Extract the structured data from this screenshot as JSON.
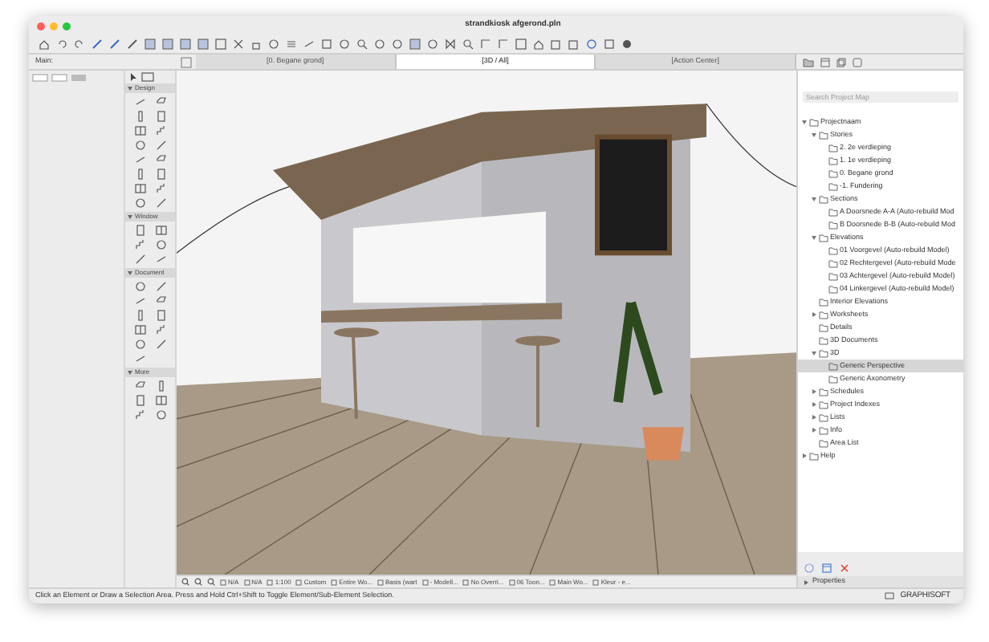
{
  "window": {
    "title": "strandkiosk afgerond.pln"
  },
  "tabs": [
    {
      "label": "[0. Begane grond]",
      "selected": false
    },
    {
      "label": "[3D / All]",
      "selected": true
    },
    {
      "label": "[Action Center]",
      "selected": false
    }
  ],
  "info_box": {
    "label": "Main:"
  },
  "toolbox": {
    "sections": [
      {
        "title": "Design",
        "expanded": true
      },
      {
        "title": "Window",
        "expanded": true
      },
      {
        "title": "Document",
        "expanded": true
      },
      {
        "title": "More",
        "expanded": true
      }
    ]
  },
  "navigator": {
    "search": {
      "placeholder": "Search Project Map"
    },
    "tree": [
      {
        "label": "Projectnaam",
        "expanded": true,
        "selected": false,
        "children": [
          {
            "label": "Stories",
            "expanded": true,
            "selected": false,
            "children": [
              {
                "label": "2. 2e verdieping",
                "selected": false
              },
              {
                "label": "1. 1e verdieping",
                "selected": false
              },
              {
                "label": "0. Begane grond",
                "selected": false
              },
              {
                "label": "-1. Fundering",
                "selected": false
              }
            ]
          },
          {
            "label": "Sections",
            "expanded": true,
            "selected": false,
            "children": [
              {
                "label": "A Doorsnede A-A (Auto-rebuild Mod",
                "selected": false
              },
              {
                "label": "B Doorsnede B-B (Auto-rebuild Mod",
                "selected": false
              }
            ]
          },
          {
            "label": "Elevations",
            "expanded": true,
            "selected": false,
            "children": [
              {
                "label": "01 Voorgevel (Auto-rebuild Model)",
                "selected": false
              },
              {
                "label": "02 Rechtergevel (Auto-rebuild Mode",
                "selected": false
              },
              {
                "label": "03 Achtergevel (Auto-rebuild Model)",
                "selected": false
              },
              {
                "label": "04 Linkergevel (Auto-rebuild Model)",
                "selected": false
              }
            ]
          },
          {
            "label": "Interior Elevations",
            "selected": false
          },
          {
            "label": "Worksheets",
            "expanded": false,
            "selected": false
          },
          {
            "label": "Details",
            "selected": false
          },
          {
            "label": "3D Documents",
            "selected": false
          },
          {
            "label": "3D",
            "expanded": true,
            "selected": false,
            "children": [
              {
                "label": "Generic Perspective",
                "selected": true
              },
              {
                "label": "Generic Axonometry",
                "selected": false
              }
            ]
          },
          {
            "label": "Schedules",
            "expanded": false,
            "selected": false
          },
          {
            "label": "Project Indexes",
            "expanded": false,
            "selected": false
          },
          {
            "label": "Lists",
            "expanded": false,
            "selected": false
          },
          {
            "label": "Info",
            "expanded": false,
            "selected": false
          },
          {
            "label": "Area List",
            "selected": false
          }
        ]
      },
      {
        "label": "Help",
        "expanded": false,
        "selected": false
      }
    ],
    "properties": {
      "title": "Properties",
      "expanded": false
    }
  },
  "view_controls": [
    "N/A",
    "N/A",
    "1:100",
    "Custom",
    "Entire Wo...",
    "Basis (wart",
    "- Modell...",
    "No Overri...",
    "06 Toon...",
    "Main Wo...",
    "Kleur - e..."
  ],
  "status_bar": {
    "message": "Click an Element or Draw a Selection Area. Press and Hold Ctrl+Shift to Toggle Element/Sub-Element Selection.",
    "brand": "GRAPHISOFT"
  }
}
